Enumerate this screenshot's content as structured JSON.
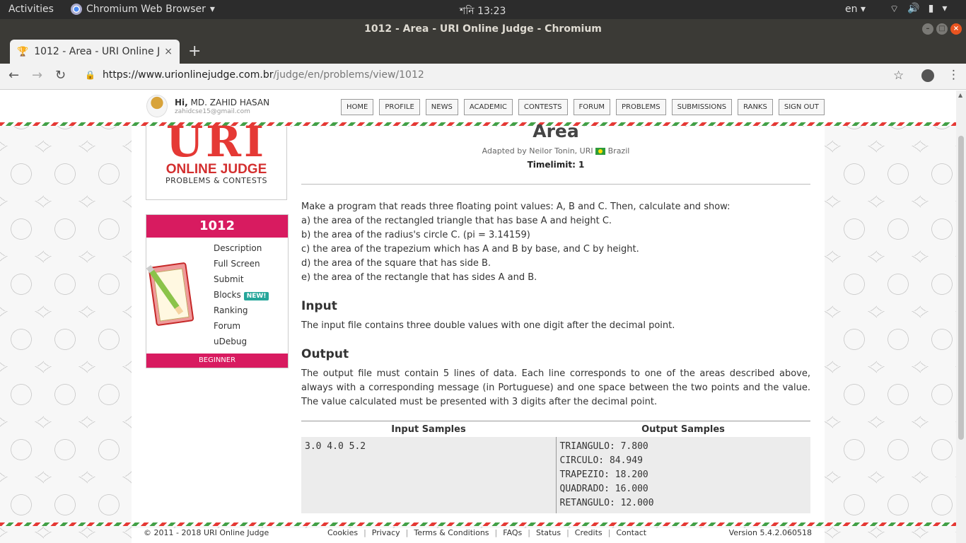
{
  "os": {
    "activities": "Activities",
    "app_name": "Chromium Web Browser",
    "clock": "শনি 13:23",
    "lang": "en"
  },
  "window": {
    "title": "1012 - Area - URI Online Judge - Chromium"
  },
  "tab": {
    "label": "1012 - Area - URI Online Ju",
    "close": "×",
    "new_tab": "+"
  },
  "omnibox": {
    "url_host": "https://www.urionlinejudge.com.br",
    "url_path": "/judge/en/problems/view/1012"
  },
  "user": {
    "greeting": "Hi,",
    "name": "MD. ZAHID HASAN",
    "email": "zahidcse15@gmail.com"
  },
  "nav": [
    "HOME",
    "PROFILE",
    "NEWS",
    "ACADEMIC",
    "CONTESTS",
    "FORUM",
    "PROBLEMS",
    "SUBMISSIONS",
    "RANKS",
    "SIGN OUT"
  ],
  "logo": {
    "big": "URI",
    "line1": "ONLINE JUDGE",
    "line2": "PROBLEMS & CONTESTS"
  },
  "problem": {
    "number": "1012",
    "links": [
      "Description",
      "Full Screen",
      "Submit",
      "Blocks",
      "Ranking",
      "Forum",
      "uDebug"
    ],
    "new_badge": "NEW!",
    "level": "BEGINNER",
    "title": "Area",
    "adapted": "Adapted by Neilor Tonin, URI",
    "country": "Brazil",
    "timelimit": "Timelimit: 1",
    "description": [
      "Make a program that reads three floating point values: A, B and C. Then, calculate and show:",
      "a) the area of the rectangled triangle that has base A and height C.",
      "b) the area of the radius's circle C. (pi = 3.14159)",
      "c) the area of the trapezium which has A and B by base, and C by height.",
      "d) the area of the square that has side B.",
      "e) the area of the rectangle that has sides A and B."
    ],
    "input_heading": "Input",
    "input_text": "The input file contains three double values with one digit after the decimal point.",
    "output_heading": "Output",
    "output_text": "The output file must contain 5 lines of data. Each line corresponds to one of the areas described above, always with a corresponding message (in Portuguese) and one space between the two points and the value. The value calculated must be presented with 3 digits after the decimal point.",
    "samples_in_heading": "Input Samples",
    "samples_out_heading": "Output Samples",
    "sample_in": "3.0 4.0 5.2",
    "sample_out": [
      "TRIANGULO: 7.800",
      "CIRCULO: 84.949",
      "TRAPEZIO: 18.200",
      "QUADRADO: 16.000",
      "RETANGULO: 12.000"
    ]
  },
  "footer": {
    "copyright": "© 2011 - 2018 URI Online Judge",
    "links": [
      "Cookies",
      "Privacy",
      "Terms & Conditions",
      "FAQs",
      "Status",
      "Credits",
      "Contact"
    ],
    "version": "Version 5.4.2.060518"
  },
  "colors": {
    "accent": "#d81b60",
    "logo_red": "#e53935",
    "badge_new": "#26a69a",
    "close_button": "#e95420"
  }
}
